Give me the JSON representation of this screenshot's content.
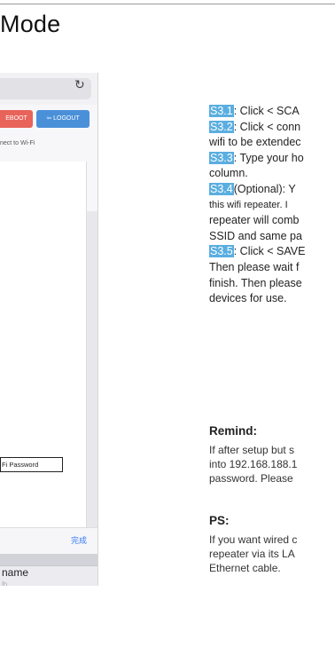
{
  "page": {
    "title": "Mode"
  },
  "phone": {
    "reload_glyph": "↻",
    "reboot_label": "EBOOT",
    "logout_label": "⇦ LOGOUT",
    "connect_text": "nect to Wi-Fi",
    "password_box": "Fi Password",
    "done_label": "完成",
    "name_label": "name",
    "sub_label": "lh"
  },
  "steps": [
    {
      "tag": "S3.1",
      "text": ": Click < SCA"
    },
    {
      "tag": "S3.2",
      "text": ": Click < conn"
    },
    {
      "text": "wifi to be extendec"
    },
    {
      "tag": "S3.3",
      "text": ": Type your ho"
    },
    {
      "text": "column."
    },
    {
      "tag": "S3.4",
      "text": "(Optional):  Y"
    },
    {
      "text": "this wifi repeater. I"
    },
    {
      "text": "repeater will comb"
    },
    {
      "text": "SSID and same pa"
    },
    {
      "tag": "S3.5",
      "text": ": Click < SAVE"
    },
    {
      "text": "Then please wait f"
    },
    {
      "text": "finish. Then please"
    },
    {
      "text": "devices for use."
    }
  ],
  "remind": {
    "heading": "Remind:",
    "lines": [
      "If after setup but s",
      "into 192.168.188.1",
      "password. Please"
    ]
  },
  "ps": {
    "heading": "PS:",
    "lines": [
      "If you want wired c",
      "repeater via its LA",
      "Ethernet cable."
    ]
  }
}
